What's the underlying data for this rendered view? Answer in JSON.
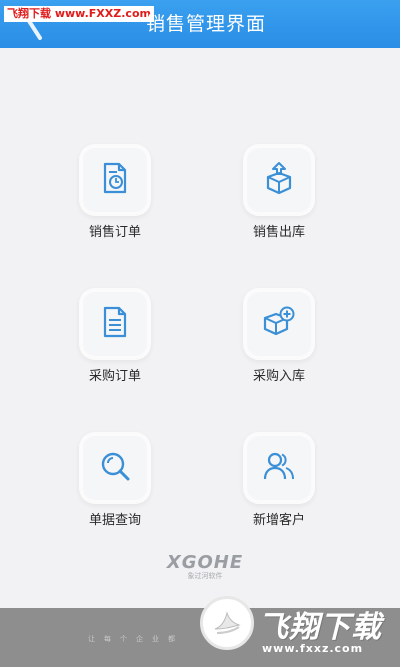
{
  "watermark_top": "飞翔下载 www.FXXZ.com",
  "header": {
    "title": "销售管理界面"
  },
  "tiles": [
    {
      "label": "销售订单",
      "icon": "sales-order-icon"
    },
    {
      "label": "销售出库",
      "icon": "sales-outbound-icon"
    },
    {
      "label": "采购订单",
      "icon": "purchase-order-icon"
    },
    {
      "label": "采购入库",
      "icon": "purchase-inbound-icon"
    },
    {
      "label": "单据查询",
      "icon": "document-search-icon"
    },
    {
      "label": "新增客户",
      "icon": "new-customer-icon"
    }
  ],
  "logo": {
    "main": "XGOHE",
    "sub": "象过河软件"
  },
  "footer": {
    "slogan": "让每个企业都",
    "brand_name": "飞翔下载",
    "brand_url": "www.fxxz.com"
  },
  "colors": {
    "header": "#2a8ee6",
    "icon": "#3a8fd6",
    "background": "#f2f2f4"
  }
}
